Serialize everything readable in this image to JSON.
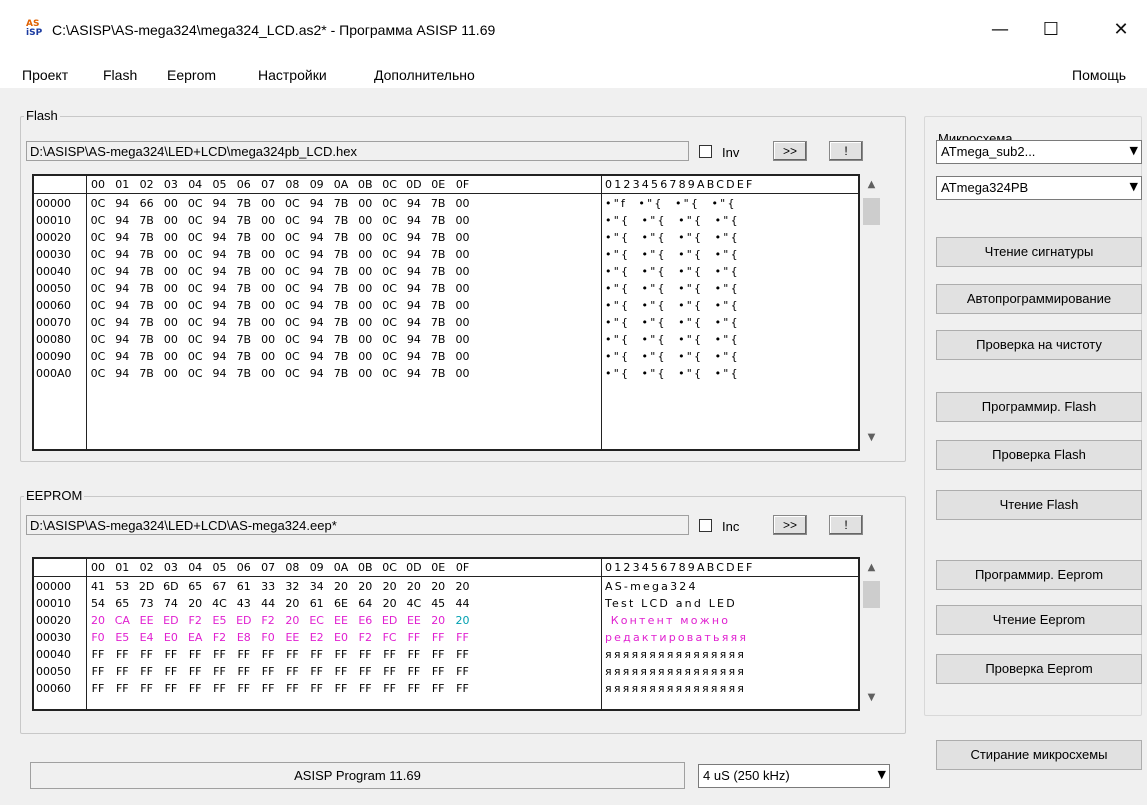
{
  "window": {
    "title": "C:\\ASISP\\AS-mega324\\mega324_LCD.as2* - Программа ASISP 11.69",
    "icon_top": "AS",
    "icon_bottom": "iSP",
    "minimize_icon": "minimize-icon",
    "maximize_icon": "maximize-icon",
    "close_icon": "close-icon"
  },
  "menu": [
    "Проект",
    "Flash",
    "Eeprom",
    "Настройки",
    "Дополнительно"
  ],
  "menu_help": "Помощь",
  "flash": {
    "group_label": "Flash",
    "path": "D:\\ASISP\\AS-mega324\\LED+LCD\\mega324pb_LCD.hex",
    "inv_label": "Inv",
    "btn_next": ">>",
    "btn_excl": "!",
    "hex_header": [
      "00",
      "01",
      "02",
      "03",
      "04",
      "05",
      "06",
      "07",
      "08",
      "09",
      "0A",
      "0B",
      "0C",
      "0D",
      "0E",
      "0F"
    ],
    "ascii_header": "0123456789ABCDEF",
    "rows": [
      {
        "addr": "00000",
        "bytes": [
          "0C",
          "94",
          "66",
          "00",
          "0C",
          "94",
          "7B",
          "00",
          "0C",
          "94",
          "7B",
          "00",
          "0C",
          "94",
          "7B",
          "00"
        ],
        "ascii": "•\"f  •\"{  •\"{  •\"{"
      },
      {
        "addr": "00010",
        "bytes": [
          "0C",
          "94",
          "7B",
          "00",
          "0C",
          "94",
          "7B",
          "00",
          "0C",
          "94",
          "7B",
          "00",
          "0C",
          "94",
          "7B",
          "00"
        ],
        "ascii": "•\"{  •\"{  •\"{  •\"{"
      },
      {
        "addr": "00020",
        "bytes": [
          "0C",
          "94",
          "7B",
          "00",
          "0C",
          "94",
          "7B",
          "00",
          "0C",
          "94",
          "7B",
          "00",
          "0C",
          "94",
          "7B",
          "00"
        ],
        "ascii": "•\"{  •\"{  •\"{  •\"{"
      },
      {
        "addr": "00030",
        "bytes": [
          "0C",
          "94",
          "7B",
          "00",
          "0C",
          "94",
          "7B",
          "00",
          "0C",
          "94",
          "7B",
          "00",
          "0C",
          "94",
          "7B",
          "00"
        ],
        "ascii": "•\"{  •\"{  •\"{  •\"{"
      },
      {
        "addr": "00040",
        "bytes": [
          "0C",
          "94",
          "7B",
          "00",
          "0C",
          "94",
          "7B",
          "00",
          "0C",
          "94",
          "7B",
          "00",
          "0C",
          "94",
          "7B",
          "00"
        ],
        "ascii": "•\"{  •\"{  •\"{  •\"{"
      },
      {
        "addr": "00050",
        "bytes": [
          "0C",
          "94",
          "7B",
          "00",
          "0C",
          "94",
          "7B",
          "00",
          "0C",
          "94",
          "7B",
          "00",
          "0C",
          "94",
          "7B",
          "00"
        ],
        "ascii": "•\"{  •\"{  •\"{  •\"{"
      },
      {
        "addr": "00060",
        "bytes": [
          "0C",
          "94",
          "7B",
          "00",
          "0C",
          "94",
          "7B",
          "00",
          "0C",
          "94",
          "7B",
          "00",
          "0C",
          "94",
          "7B",
          "00"
        ],
        "ascii": "•\"{  •\"{  •\"{  •\"{"
      },
      {
        "addr": "00070",
        "bytes": [
          "0C",
          "94",
          "7B",
          "00",
          "0C",
          "94",
          "7B",
          "00",
          "0C",
          "94",
          "7B",
          "00",
          "0C",
          "94",
          "7B",
          "00"
        ],
        "ascii": "•\"{  •\"{  •\"{  •\"{"
      },
      {
        "addr": "00080",
        "bytes": [
          "0C",
          "94",
          "7B",
          "00",
          "0C",
          "94",
          "7B",
          "00",
          "0C",
          "94",
          "7B",
          "00",
          "0C",
          "94",
          "7B",
          "00"
        ],
        "ascii": "•\"{  •\"{  •\"{  •\"{"
      },
      {
        "addr": "00090",
        "bytes": [
          "0C",
          "94",
          "7B",
          "00",
          "0C",
          "94",
          "7B",
          "00",
          "0C",
          "94",
          "7B",
          "00",
          "0C",
          "94",
          "7B",
          "00"
        ],
        "ascii": "•\"{  •\"{  •\"{  •\"{"
      },
      {
        "addr": "000A0",
        "bytes": [
          "0C",
          "94",
          "7B",
          "00",
          "0C",
          "94",
          "7B",
          "00",
          "0C",
          "94",
          "7B",
          "00",
          "0C",
          "94",
          "7B",
          "00"
        ],
        "ascii": "•\"{  •\"{  •\"{  •\"{"
      }
    ]
  },
  "eeprom": {
    "group_label": "EEPROM",
    "path": "D:\\ASISP\\AS-mega324\\LED+LCD\\AS-mega324.eep*",
    "inc_label": "Inc",
    "btn_next": ">>",
    "btn_excl": "!",
    "hex_header": [
      "00",
      "01",
      "02",
      "03",
      "04",
      "05",
      "06",
      "07",
      "08",
      "09",
      "0A",
      "0B",
      "0C",
      "0D",
      "0E",
      "0F"
    ],
    "ascii_header": "0123456789ABCDEF",
    "rows": [
      {
        "addr": "00000",
        "bytes": [
          "41",
          "53",
          "2D",
          "6D",
          "65",
          "67",
          "61",
          "33",
          "32",
          "34",
          "20",
          "20",
          "20",
          "20",
          "20",
          "20"
        ],
        "ascii": "AS-mega324      ",
        "color": ""
      },
      {
        "addr": "00010",
        "bytes": [
          "54",
          "65",
          "73",
          "74",
          "20",
          "4C",
          "43",
          "44",
          "20",
          "61",
          "6E",
          "64",
          "20",
          "4C",
          "45",
          "44"
        ],
        "ascii": "Test LCD and LED",
        "color": ""
      },
      {
        "addr": "00020",
        "bytes": [
          "20",
          "CA",
          "EE",
          "ED",
          "F2",
          "E5",
          "ED",
          "F2",
          "20",
          "EC",
          "EE",
          "E6",
          "ED",
          "EE",
          "20",
          "20"
        ],
        "ascii": " Контент можно  ",
        "color": "#e020d0"
      },
      {
        "addr": "00030",
        "bytes": [
          "F0",
          "E5",
          "E4",
          "E0",
          "EA",
          "F2",
          "E8",
          "F0",
          "EE",
          "E2",
          "E0",
          "F2",
          "FC",
          "FF",
          "FF",
          "FF"
        ],
        "ascii": "редактироватьяяя",
        "color": "#e020d0"
      },
      {
        "addr": "00040",
        "bytes": [
          "FF",
          "FF",
          "FF",
          "FF",
          "FF",
          "FF",
          "FF",
          "FF",
          "FF",
          "FF",
          "FF",
          "FF",
          "FF",
          "FF",
          "FF",
          "FF"
        ],
        "ascii": "яяяяяяяяяяяяяяяя",
        "color": ""
      },
      {
        "addr": "00050",
        "bytes": [
          "FF",
          "FF",
          "FF",
          "FF",
          "FF",
          "FF",
          "FF",
          "FF",
          "FF",
          "FF",
          "FF",
          "FF",
          "FF",
          "FF",
          "FF",
          "FF"
        ],
        "ascii": "яяяяяяяяяяяяяяяя",
        "color": ""
      },
      {
        "addr": "00060",
        "bytes": [
          "FF",
          "FF",
          "FF",
          "FF",
          "FF",
          "FF",
          "FF",
          "FF",
          "FF",
          "FF",
          "FF",
          "FF",
          "FF",
          "FF",
          "FF",
          "FF"
        ],
        "ascii": "яяяяяяяяяяяяяяяя",
        "color": ""
      }
    ]
  },
  "chip": {
    "group_label": "Микросхема",
    "family": "ATmega_sub2...",
    "model": "ATmega324PB"
  },
  "buttons": {
    "read_signature": "Чтение сигнатуры",
    "auto_program": "Автопрограммирование",
    "blank_check": "Проверка на чистоту",
    "program_flash": "Программир. Flash",
    "verify_flash": "Проверка Flash",
    "read_flash": "Чтение Flash",
    "program_eeprom": "Программир. Eeprom",
    "read_eeprom": "Чтение Eeprom",
    "verify_eeprom": "Проверка Eeprom",
    "erase_chip": "Стирание микросхемы"
  },
  "status": {
    "text": "ASISP Program 11.69",
    "speed": "4 uS  (250 kHz)"
  },
  "colors": {
    "eeprom_pink": "#e020d0",
    "eeprom_teal": "#00a0b0"
  }
}
